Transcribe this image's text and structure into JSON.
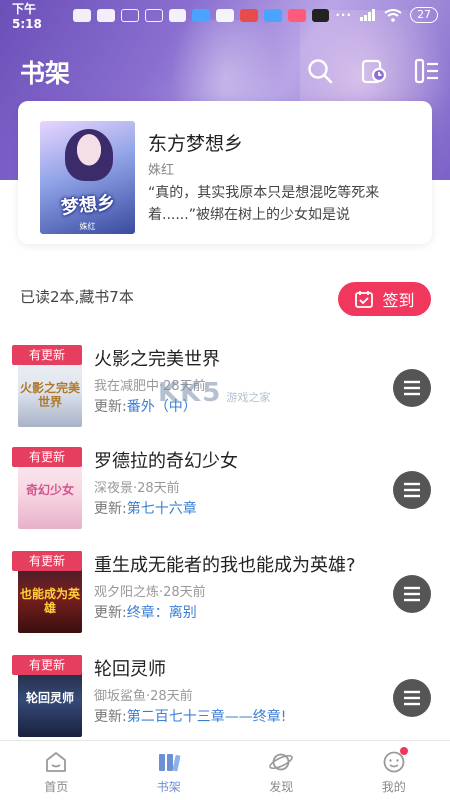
{
  "status_bar": {
    "time": "下午5:18",
    "more": "···",
    "battery": "27"
  },
  "header": {
    "title": "书架",
    "icons": [
      "search-icon",
      "history-icon",
      "list-icon"
    ]
  },
  "featured": {
    "cover_title": "梦想乡",
    "title": "东方梦想乡",
    "author": "姝红",
    "description": "“真的，其实我原本只是想混吃等死来着......”被绑在树上的少女如是说"
  },
  "stats": {
    "text": "已读2本,藏书7本",
    "signin_label": "签到"
  },
  "books": [
    {
      "tag": "有更新",
      "cover_text": "火影之完美世界",
      "name": "火影之完美世界",
      "author_time": "我在减肥中·28天前",
      "update_prefix": "更新:",
      "update_chapter": "番外（中）"
    },
    {
      "tag": "有更新",
      "cover_text": "奇幻少女",
      "name": "罗德拉的奇幻少女",
      "author_time": "深夜景·28天前",
      "update_prefix": "更新:",
      "update_chapter": "第七十六章"
    },
    {
      "tag": "有更新",
      "cover_text": "也能成为英雄",
      "name": "重生成无能者的我也能成为英雄?",
      "author_time": "观夕阳之炼·28天前",
      "update_prefix": "更新:",
      "update_chapter": "终章：离别"
    },
    {
      "tag": "有更新",
      "cover_text": "轮回灵师",
      "name": "轮回灵师",
      "author_time": "御坂鲨鱼·28天前",
      "update_prefix": "更新:",
      "update_chapter": "第二百七十三章——终章!"
    }
  ],
  "watermark": {
    "text": "KK5",
    "sub": "游戏之家"
  },
  "bottom_nav": [
    {
      "label": "首页",
      "icon": "home-icon"
    },
    {
      "label": "书架",
      "icon": "bookshelf-icon",
      "active": true
    },
    {
      "label": "发现",
      "icon": "planet-icon"
    },
    {
      "label": "我的",
      "icon": "profile-icon",
      "badge": true
    }
  ],
  "colors": {
    "accent": "#f1375d",
    "nav_active": "#6c8fd6",
    "link": "#3b7fd6"
  }
}
